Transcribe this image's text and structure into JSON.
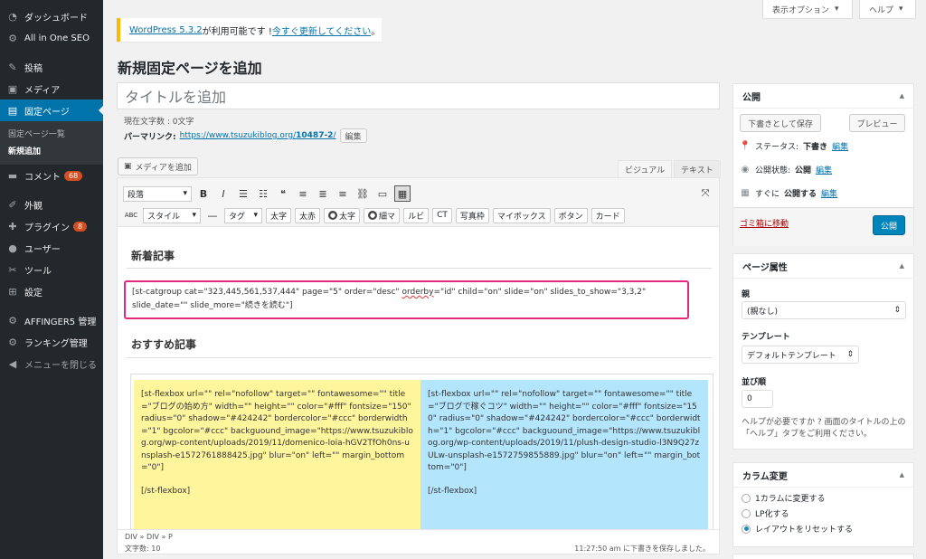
{
  "sidebar": {
    "items": [
      {
        "label": "ダッシュボード",
        "icon": "dashboard-icon"
      },
      {
        "label": "All in One SEO",
        "icon": "gear-icon"
      },
      {
        "label": "投稿",
        "icon": "pin-icon"
      },
      {
        "label": "メディア",
        "icon": "media-icon"
      },
      {
        "label": "固定ページ",
        "icon": "pages-icon"
      },
      {
        "label": "コメント",
        "icon": "comment-icon",
        "badge": "68"
      },
      {
        "label": "外観",
        "icon": "brush-icon"
      },
      {
        "label": "プラグイン",
        "icon": "plugin-icon",
        "badge": "8"
      },
      {
        "label": "ユーザー",
        "icon": "user-icon"
      },
      {
        "label": "ツール",
        "icon": "wrench-icon"
      },
      {
        "label": "設定",
        "icon": "settings-icon"
      },
      {
        "label": "AFFINGER5 管理",
        "icon": "gear-icon"
      },
      {
        "label": "ランキング管理",
        "icon": "gear-icon"
      },
      {
        "label": "メニューを閉じる",
        "icon": "collapse-icon"
      }
    ],
    "sub": [
      "固定ページ一覧",
      "新規追加"
    ]
  },
  "screen_options": "表示オプション",
  "help": "ヘルプ",
  "notice": {
    "version": "WordPress 5.3.2",
    "mid": " が利用可能です ! ",
    "link": "今すぐ更新してください",
    "end": "。"
  },
  "page_title": "新規固定ページを追加",
  "title_placeholder": "タイトルを追加",
  "char_count": "現在文字数 : 0文字",
  "permalink": {
    "label": "パーマリンク:",
    "url_base": "https://www.tsuzukiblog.org/",
    "slug": "10487-2",
    "slash": "/",
    "edit": "編集"
  },
  "editor": {
    "media_button": "メディアを追加",
    "tab_visual": "ビジュアル",
    "tab_text": "テキスト",
    "format_select": "段落",
    "style_select": "スタイル",
    "tag_select": "タグ",
    "buttons": [
      "太字",
      "太赤",
      "太字",
      "細マ",
      "ルビ",
      "CT",
      "写真枠",
      "マイボックス",
      "ボタン",
      "カード"
    ],
    "h_new": "新着記事",
    "shortcode_a": "[st-catgroup cat=\"323,445,561,537,444\" page=\"5\" order=\"desc\" ",
    "shortcode_b": "orderby",
    "shortcode_c": "=\"id\" child=\"on\" slide=\"on\" slides_to_show=\"3,3,2\" slide_date=\"\" slide_more=\"続きを読む\"]",
    "h_rec": "おすすめ記事",
    "left_box": "[st-flexbox url=\"\" rel=\"nofollow\" target=\"\" fontawesome=\"\" title=\"ブログの始め方\" width=\"\" height=\"\" color=\"#fff\" fontsize=\"150\" radius=\"0\" shadow=\"#424242\" bordercolor=\"#ccc\" borderwidth=\"1\" bgcolor=\"#ccc\" backguound_image=\"https://www.tsuzukiblog.org/wp-content/uploads/2019/11/domenico-loia-hGV2TfOh0ns-unsplash-e1572761888425.jpg\" blur=\"on\" left=\"\" margin_bottom=\"0\"]",
    "right_box": "[st-flexbox url=\"\" rel=\"nofollow\" target=\"\" fontawesome=\"\" title=\"ブログで稼ぐコツ\" width=\"\" height=\"\" color=\"#fff\" fontsize=\"150\" radius=\"0\" shadow=\"#424242\" bordercolor=\"#ccc\" borderwidth=\"1\" bgcolor=\"#ccc\" backguound_image=\"https://www.tsuzukiblog.org/wp-content/uploads/2019/11/plush-design-studio-l3N9Q27zULw-unsplash-e1572759855889.jpg\" blur=\"on\" left=\"\" margin_bottom=\"0\"]",
    "close_tag": "[/st-flexbox]",
    "path": "DIV » DIV » P",
    "word_count": "文字数: 10",
    "autosave": "11:27:50 am に下書きを保存しました。"
  },
  "publish": {
    "title": "公開",
    "save_draft": "下書きとして保存",
    "preview": "プレビュー",
    "status": "ステータス: ",
    "status_val": "下書き",
    "visibility": "公開状態: ",
    "visibility_val": "公開",
    "schedule": "すぐに",
    "schedule_b": "公開する",
    "edit": "編集",
    "trash": "ゴミ箱に移動",
    "publish_btn": "公開"
  },
  "page_attr": {
    "title": "ページ属性",
    "parent_label": "親",
    "parent_val": "(親なし)",
    "template_label": "テンプレート",
    "template_val": "デフォルトテンプレート",
    "order_label": "並び順",
    "order_val": "0",
    "help": "ヘルプが必要ですか ? 画面のタイトルの上の「ヘルプ」タブをご利用ください。"
  },
  "column": {
    "title": "カラム変更",
    "options": [
      "1カラムに変更する",
      "LP化する",
      "レイアウトをリセットする"
    ]
  },
  "colors": {
    "accent": "#0073aa",
    "highlight": "#e3287e",
    "yellow": "#fff59d",
    "cyan": "#b3e5fc"
  }
}
